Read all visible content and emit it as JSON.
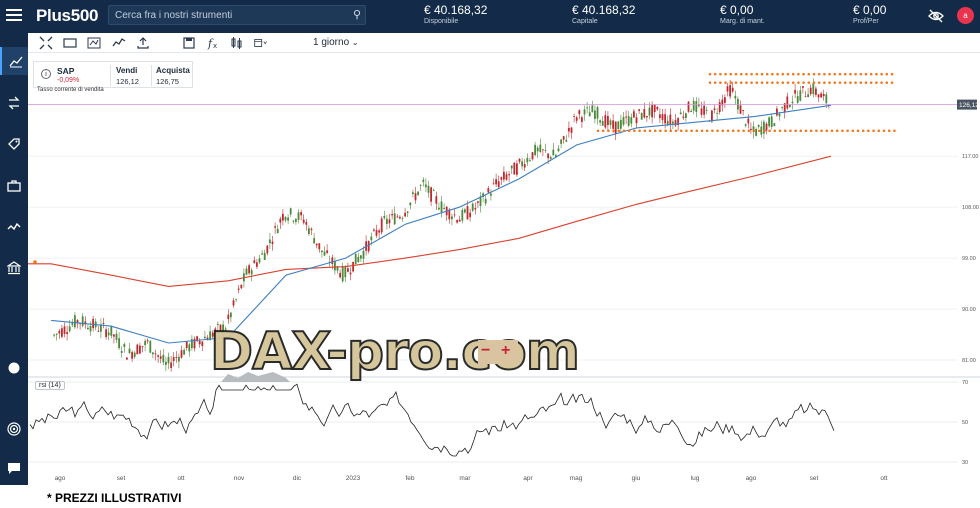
{
  "topbar": {
    "logo": "Plus500",
    "search_placeholder": "Cerca fra i nostri strumenti",
    "stats": [
      {
        "value": "€ 40.168,32",
        "label": "Disponibile"
      },
      {
        "value": "€ 40.168,32",
        "label": "Capitale"
      },
      {
        "value": "€ 0,00",
        "label": "Marg. di mant."
      },
      {
        "value": "€ 0,00",
        "label": "Prof/Per"
      }
    ],
    "avatar_initial": "a"
  },
  "sidebar": {
    "icons": [
      "chart-icon",
      "swap-icon",
      "tag-icon",
      "briefcase-icon",
      "pulse-icon",
      "bank-icon",
      "sun-icon",
      "target-icon",
      "chat-icon"
    ]
  },
  "toolbar": {
    "icons": [
      "crosshair-icon",
      "screen-icon",
      "line-tool-icon",
      "indicator-icon",
      "share-icon",
      "save-icon",
      "formula-icon",
      "candles-icon",
      "calendar-icon"
    ],
    "period": "1 giorno"
  },
  "quote": {
    "symbol": "SAP",
    "change": "-0,09%",
    "sell_label": "Vendi",
    "sell_value": "126,12",
    "buy_label": "Acquista",
    "buy_value": "126,75",
    "sell_note": "Tasso corrente di vendita"
  },
  "rsi_label": "rsi (14)",
  "watermark": {
    "text": "DAX-pro.com",
    "minus": "−",
    "plus": "+"
  },
  "footer_note": "* PREZZI ILLUSTRATIVI",
  "colors": {
    "up": "#4a8a3a",
    "down": "#c0282e",
    "sma_fast": "#3d7fc1",
    "sma_slow": "#d9422e",
    "level": "#f0781e",
    "price_line": "#d48fd8"
  },
  "chart_data": {
    "type": "line",
    "title": "",
    "x_ticks": [
      "ago",
      "set",
      "ott",
      "nov",
      "dic",
      "2023",
      "feb",
      "mar",
      "apr",
      "mag",
      "giu",
      "lug",
      "ago",
      "set",
      "ott"
    ],
    "y_ticks": [
      81,
      90,
      99,
      108,
      117
    ],
    "ylim": [
      78,
      134
    ],
    "current_price": "126,12",
    "close_series": [
      {
        "x": "2022-08",
        "y": 85
      },
      {
        "x": "2022-08-15",
        "y": 88
      },
      {
        "x": "2022-09-01",
        "y": 86
      },
      {
        "x": "2022-09-10",
        "y": 82
      },
      {
        "x": "2022-09-20",
        "y": 84
      },
      {
        "x": "2022-09-30",
        "y": 80
      },
      {
        "x": "2022-10-10",
        "y": 83
      },
      {
        "x": "2022-10-20",
        "y": 85
      },
      {
        "x": "2022-10-31",
        "y": 87
      },
      {
        "x": "2022-11-10",
        "y": 96
      },
      {
        "x": "2022-11-20",
        "y": 100
      },
      {
        "x": "2022-11-30",
        "y": 107
      },
      {
        "x": "2022-12-10",
        "y": 106
      },
      {
        "x": "2022-12-20",
        "y": 100
      },
      {
        "x": "2022-12-31",
        "y": 96
      },
      {
        "x": "2023-01-10",
        "y": 100
      },
      {
        "x": "2023-01-20",
        "y": 105
      },
      {
        "x": "2023-01-31",
        "y": 107
      },
      {
        "x": "2023-02-10",
        "y": 112
      },
      {
        "x": "2023-02-20",
        "y": 108
      },
      {
        "x": "2023-03-01",
        "y": 106
      },
      {
        "x": "2023-03-10",
        "y": 108
      },
      {
        "x": "2023-03-20",
        "y": 112
      },
      {
        "x": "2023-03-31",
        "y": 115
      },
      {
        "x": "2023-04-10",
        "y": 118
      },
      {
        "x": "2023-04-20",
        "y": 117
      },
      {
        "x": "2023-05-01",
        "y": 124
      },
      {
        "x": "2023-05-10",
        "y": 125
      },
      {
        "x": "2023-05-20",
        "y": 122
      },
      {
        "x": "2023-05-31",
        "y": 124
      },
      {
        "x": "2023-06-10",
        "y": 125
      },
      {
        "x": "2023-06-20",
        "y": 123
      },
      {
        "x": "2023-06-30",
        "y": 126
      },
      {
        "x": "2023-07-10",
        "y": 124
      },
      {
        "x": "2023-07-20",
        "y": 129
      },
      {
        "x": "2023-07-31",
        "y": 121
      },
      {
        "x": "2023-08-10",
        "y": 123
      },
      {
        "x": "2023-08-20",
        "y": 127
      },
      {
        "x": "2023-08-31",
        "y": 129
      },
      {
        "x": "2023-09-10",
        "y": 126
      }
    ],
    "sma_fast": [
      {
        "x": "2022-08",
        "y": 88
      },
      {
        "x": "2022-09-01",
        "y": 87
      },
      {
        "x": "2022-10-01",
        "y": 84
      },
      {
        "x": "2022-11-01",
        "y": 85
      },
      {
        "x": "2022-12-01",
        "y": 96
      },
      {
        "x": "2023-01-01",
        "y": 99
      },
      {
        "x": "2023-02-01",
        "y": 105
      },
      {
        "x": "2023-03-01",
        "y": 108
      },
      {
        "x": "2023-04-01",
        "y": 113
      },
      {
        "x": "2023-05-01",
        "y": 119
      },
      {
        "x": "2023-06-01",
        "y": 122
      },
      {
        "x": "2023-07-01",
        "y": 123
      },
      {
        "x": "2023-08-01",
        "y": 124
      },
      {
        "x": "2023-09-10",
        "y": 126
      }
    ],
    "sma_slow": [
      {
        "x": "2022-08",
        "y": 98
      },
      {
        "x": "2022-09-01",
        "y": 96
      },
      {
        "x": "2022-10-01",
        "y": 94
      },
      {
        "x": "2022-11-01",
        "y": 95
      },
      {
        "x": "2022-12-01",
        "y": 97
      },
      {
        "x": "2023-01-01",
        "y": 97.5
      },
      {
        "x": "2023-02-01",
        "y": 99
      },
      {
        "x": "2023-03-01",
        "y": 100.5
      },
      {
        "x": "2023-04-01",
        "y": 102.5
      },
      {
        "x": "2023-05-01",
        "y": 105.5
      },
      {
        "x": "2023-06-01",
        "y": 108.5
      },
      {
        "x": "2023-07-01",
        "y": 111
      },
      {
        "x": "2023-08-01",
        "y": 113.5
      },
      {
        "x": "2023-09-10",
        "y": 117
      }
    ],
    "levels": [
      131.5,
      130,
      121.5
    ],
    "rsi": {
      "ylim": [
        30,
        70
      ],
      "y_ticks": [
        70,
        50,
        30
      ]
    }
  }
}
